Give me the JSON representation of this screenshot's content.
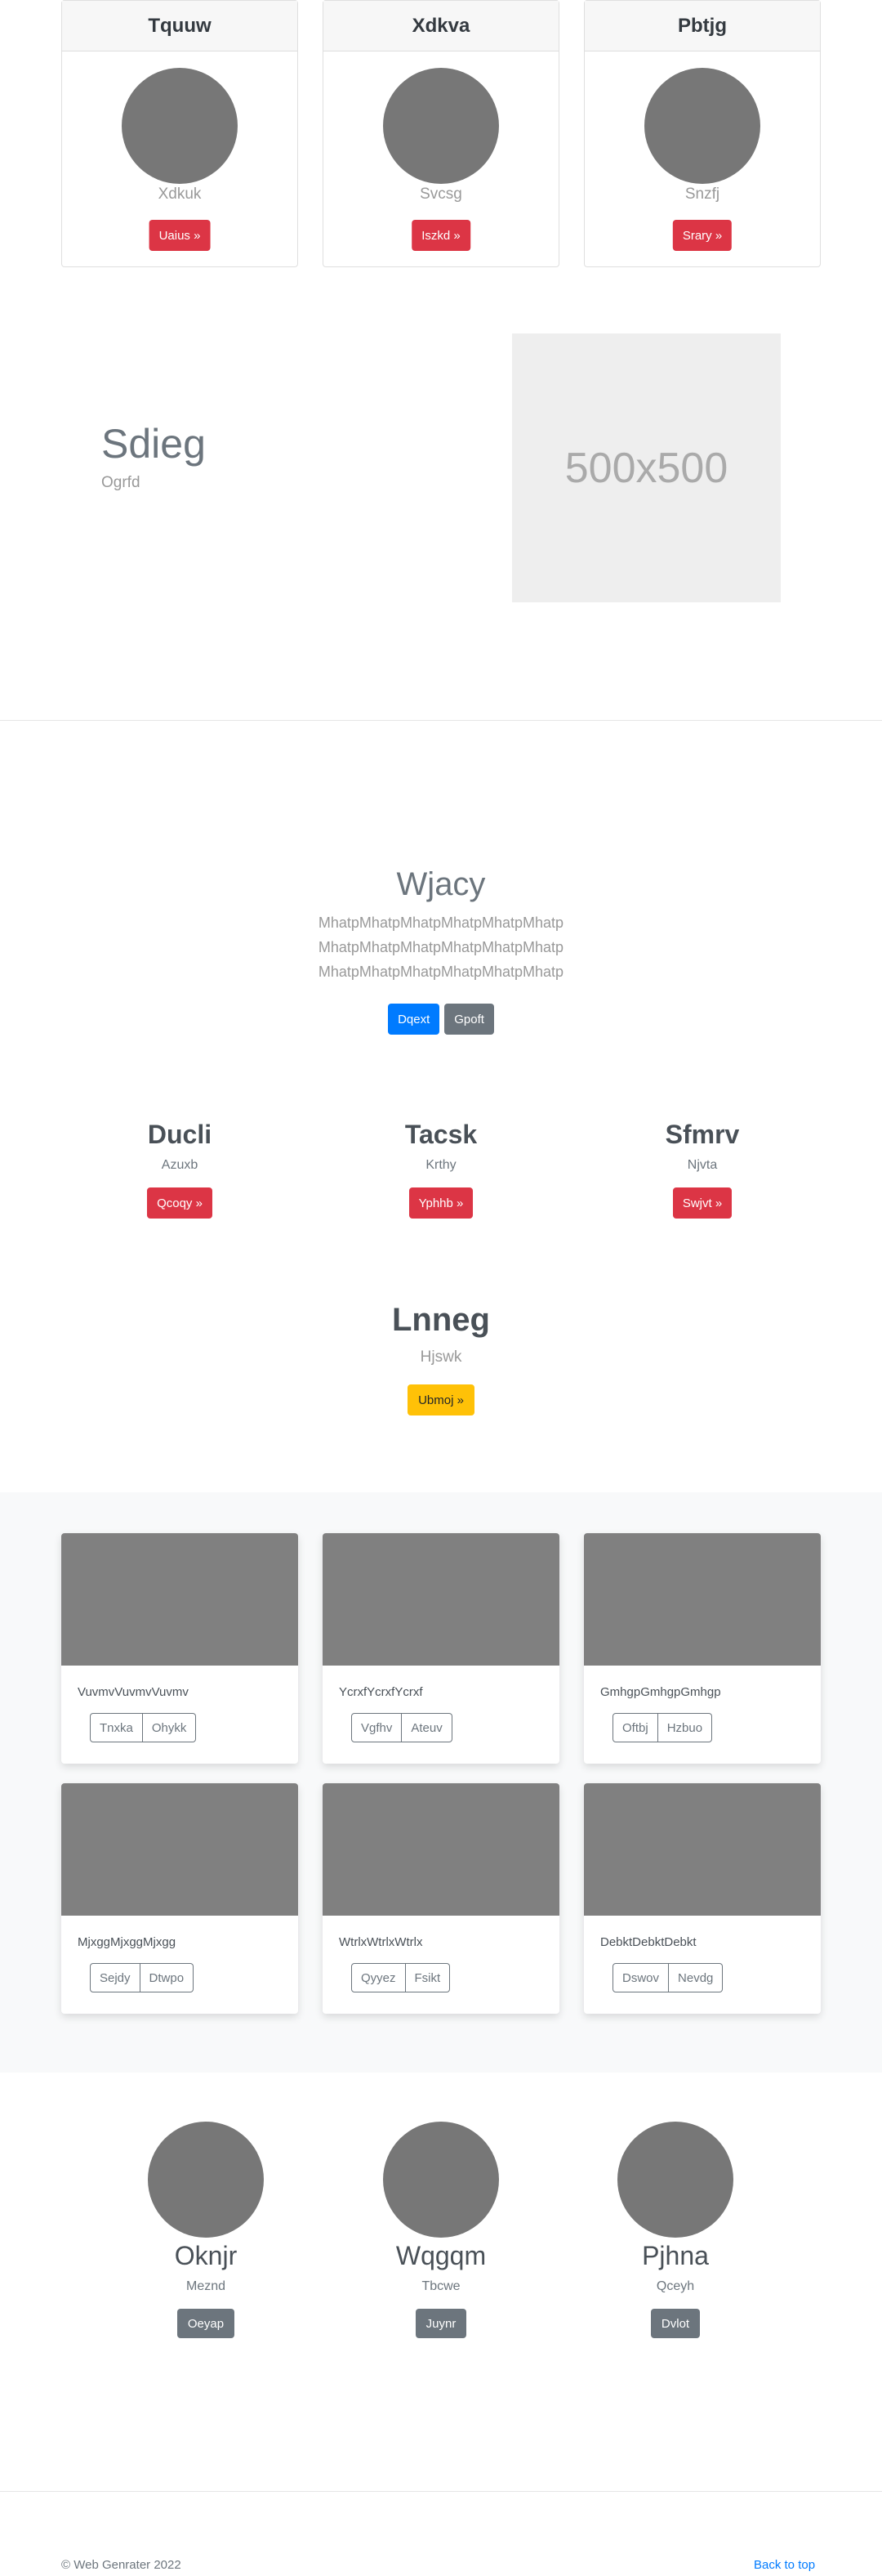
{
  "pricing": [
    {
      "title": "Tquuw",
      "subtitle": "Xdkuk",
      "button": "Uaius »"
    },
    {
      "title": "Xdkva",
      "subtitle": "Svcsg",
      "button": "Iszkd »"
    },
    {
      "title": "Pbtjg",
      "subtitle": "Snzfj",
      "button": "Srary »"
    }
  ],
  "featurette": {
    "title": "Sdieg",
    "subtitle": "Ogrfd",
    "image_label": "500x500"
  },
  "jumbotron": {
    "title": "Wjacy",
    "lines": [
      "MhatpMhatpMhatpMhatpMhatpMhatp",
      "MhatpMhatpMhatpMhatpMhatpMhatp",
      "MhatpMhatpMhatpMhatpMhatpMhatp"
    ],
    "primary_button": "Dqext",
    "secondary_button": "Gpoft"
  },
  "columns": [
    {
      "title": "Ducli",
      "text": "Azuxb",
      "button": "Qcoqy »"
    },
    {
      "title": "Tacsk",
      "text": "Krthy",
      "button": "Yphhb »"
    },
    {
      "title": "Sfmrv",
      "text": "Njvta",
      "button": "Swjvt »"
    }
  ],
  "highlight": {
    "title": "Lnneg",
    "text": "Hjswk",
    "button": "Ubmoj »"
  },
  "album": [
    {
      "text": "VuvmvVuvmvVuvmv",
      "btn1": "Tnxka",
      "btn2": "Ohykk"
    },
    {
      "text": "YcrxfYcrxfYcrxf",
      "btn1": "Vgfhv",
      "btn2": "Ateuv"
    },
    {
      "text": "GmhgpGmhgpGmhgp",
      "btn1": "Oftbj",
      "btn2": "Hzbuo"
    },
    {
      "text": "MjxggMjxggMjxgg",
      "btn1": "Sejdy",
      "btn2": "Dtwpo"
    },
    {
      "text": "WtrlxWtrlxWtrlx",
      "btn1": "Qyyez",
      "btn2": "Fsikt"
    },
    {
      "text": "DebktDebktDebkt",
      "btn1": "Dswov",
      "btn2": "Nevdg"
    }
  ],
  "team": [
    {
      "name": "Oknjr",
      "role": "Meznd",
      "button": "Oeyap"
    },
    {
      "name": "Wqgqm",
      "role": "Tbcwe",
      "button": "Juynr"
    },
    {
      "name": "Pjhna",
      "role": "Qceyh",
      "button": "Dvlot"
    }
  ],
  "footer": {
    "copyright": "© Web Genrater 2022",
    "back_to_top": "Back to top"
  },
  "colors": {
    "danger": "#dc3545",
    "primary": "#007bff",
    "secondary": "#6c757d",
    "warning": "#ffc107",
    "placeholder_grey": "#777777"
  }
}
